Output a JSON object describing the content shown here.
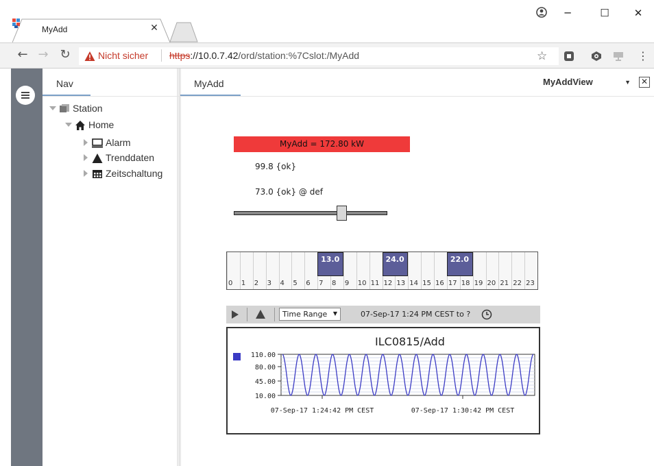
{
  "browser": {
    "tab_title": "MyAdd",
    "security_label": "Nicht sicher",
    "url_scheme": "https",
    "url_host": "://10.0.7.42",
    "url_path": "/ord/station:%7Cslot:/MyAdd"
  },
  "nav": {
    "tab_label": "Nav",
    "tree": [
      {
        "label": "Station",
        "icon": "station-icon"
      },
      {
        "label": "Home",
        "icon": "home-icon"
      },
      {
        "label": "Alarm",
        "icon": "monitor-icon"
      },
      {
        "label": "Trenddaten",
        "icon": "triangle-icon"
      },
      {
        "label": "Zeitschaltung",
        "icon": "grid-icon"
      }
    ]
  },
  "view": {
    "tab_label": "MyAdd",
    "selector": "MyAddView",
    "readout": "MyAdd = 172.80 kW",
    "value_1": "99.8 {ok}",
    "value_2": "73.0 {ok} @ def",
    "slider_level": 0.72,
    "accent_color": "#ef3a3a"
  },
  "schedule": {
    "hours": [
      "0",
      "1",
      "2",
      "3",
      "4",
      "5",
      "6",
      "7",
      "8",
      "9",
      "10",
      "11",
      "12",
      "13",
      "14",
      "15",
      "16",
      "17",
      "18",
      "19",
      "20",
      "21",
      "22",
      "23"
    ],
    "blocks": [
      {
        "start": 7,
        "end": 9,
        "label": "13.0"
      },
      {
        "start": 12,
        "end": 14,
        "label": "24.0"
      },
      {
        "start": 17,
        "end": 19,
        "label": "22.0"
      }
    ],
    "block_color": "#5c5e99"
  },
  "chart_toolbar": {
    "time_range_label": "Time Range",
    "range_text": "07-Sep-17 1:24 PM CEST to ?"
  },
  "chart_data": {
    "type": "line",
    "title": "ILC0815/Add",
    "y_ticks": [
      "110.00",
      "80.00",
      "45.00",
      "10.00"
    ],
    "ylim": [
      10,
      110
    ],
    "x_labels": [
      "07-Sep-17 1:24:42 PM CEST",
      "07-Sep-17 1:30:42 PM CEST"
    ],
    "series": [
      {
        "color": "#3b3bc4",
        "cycles": 15,
        "min": 10,
        "max": 110
      }
    ],
    "grid": true
  }
}
